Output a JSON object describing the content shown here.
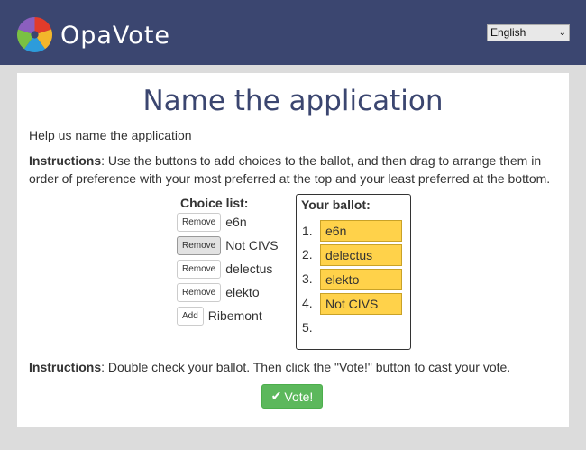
{
  "header": {
    "brand": "OpaVote",
    "language": {
      "selected": "English"
    }
  },
  "page": {
    "title": "Name the application",
    "help": "Help us name the application",
    "instructions_label": "Instructions",
    "instructions_text": ": Use the buttons to add choices to the ballot, and then drag to arrange them in order of preference with your most preferred at the top and your least preferred at the bottom.",
    "instructions2_label": "Instructions",
    "instructions2_text": ": Double check your ballot. Then click the \"Vote!\" button to cast your vote."
  },
  "choices": {
    "heading": "Choice list:",
    "items": [
      {
        "button": "Remove",
        "label": "e6n"
      },
      {
        "button": "Remove",
        "label": "Not CIVS"
      },
      {
        "button": "Remove",
        "label": "delectus"
      },
      {
        "button": "Remove",
        "label": "elekto"
      },
      {
        "button": "Add",
        "label": "Ribemont"
      }
    ]
  },
  "ballot": {
    "heading": "Your ballot:",
    "numbers": [
      "1.",
      "2.",
      "3.",
      "4.",
      "5."
    ],
    "entries": [
      "e6n",
      "delectus",
      "elekto",
      "Not CIVS"
    ]
  },
  "vote_button": "Vote!",
  "colors": {
    "header": "#3b4670",
    "slot": "#ffd24a",
    "vote": "#5cb85c"
  },
  "icons": {
    "check": "check-icon",
    "logo": "opavote-logo-icon",
    "dropdown": "chevron-down-icon"
  }
}
